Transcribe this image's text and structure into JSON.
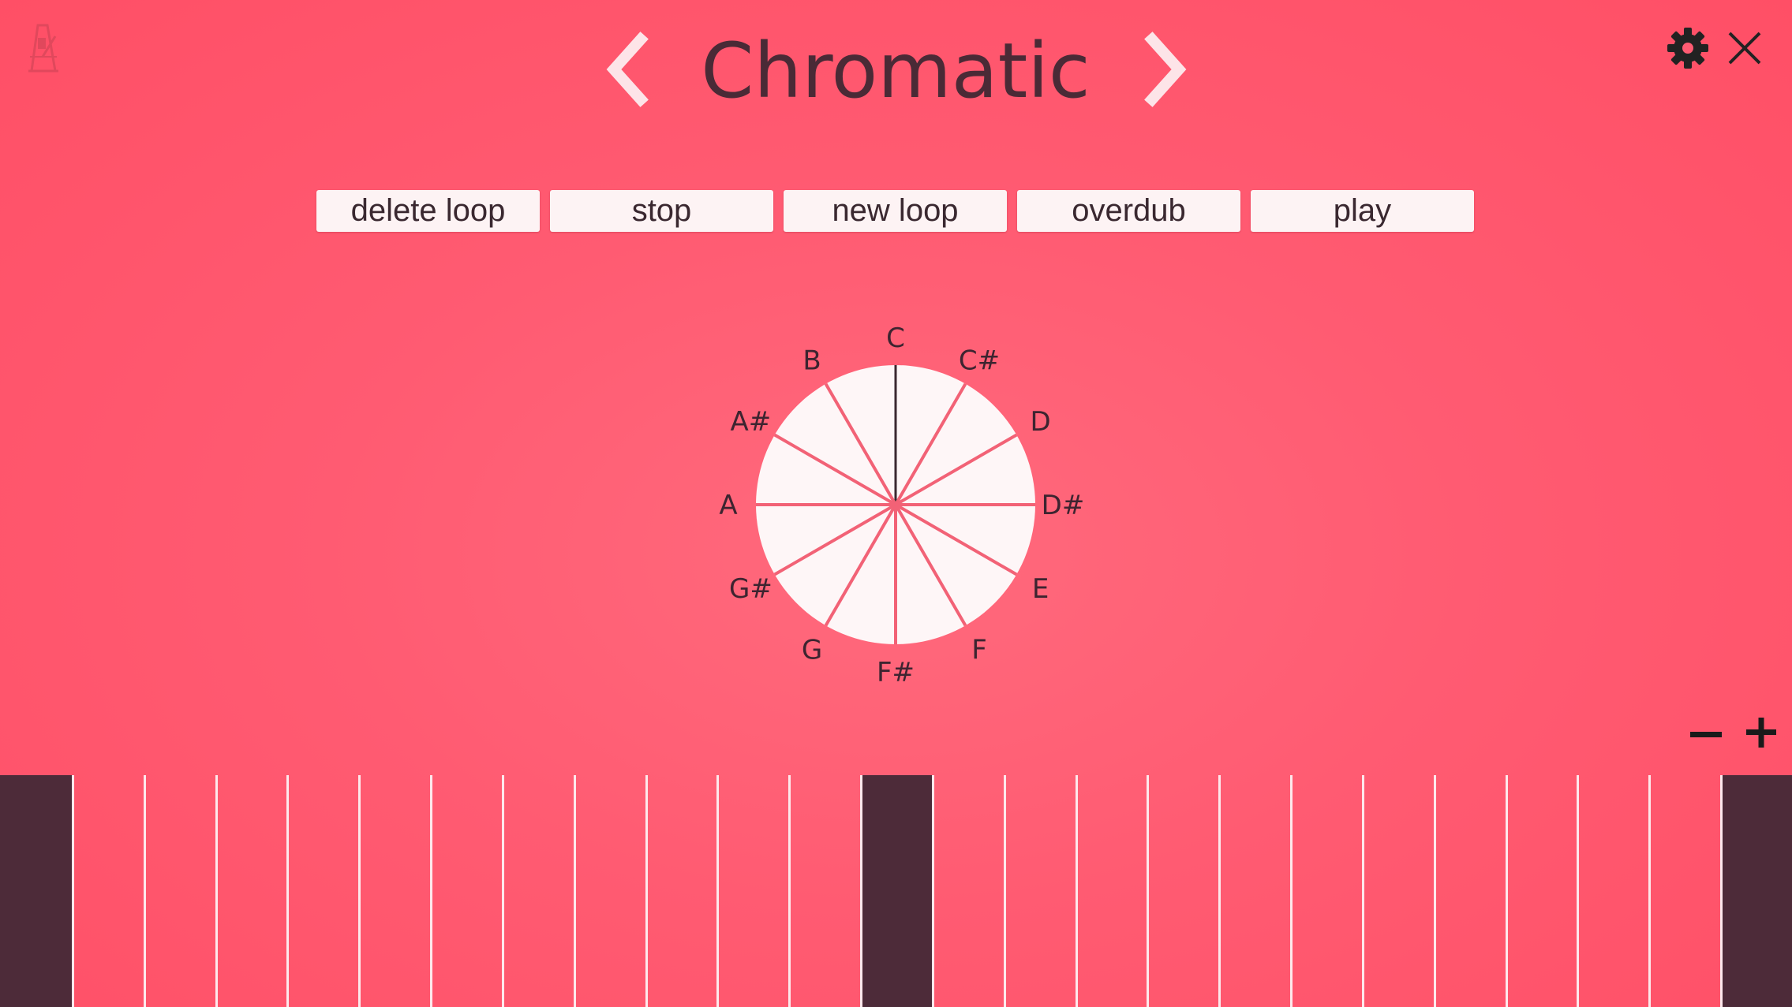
{
  "header": {
    "title": "Chromatic",
    "icons": {
      "metronome": "metronome-icon",
      "prev": "chevron-left-icon",
      "next": "chevron-right-icon",
      "settings": "gear-icon",
      "close": "close-icon"
    }
  },
  "loop_controls": {
    "delete_loop": "delete loop",
    "stop": "stop",
    "new_loop": "new loop",
    "overdub": "overdub",
    "play": "play"
  },
  "note_wheel": {
    "notes": [
      "C",
      "C#",
      "D",
      "D#",
      "E",
      "F",
      "F#",
      "G",
      "G#",
      "A",
      "A#",
      "B"
    ],
    "selected_note": "C"
  },
  "zoom": {
    "minus_icon": "minus-icon",
    "plus_icon": "plus-icon"
  },
  "keyboard": {
    "key_count": 25,
    "highlighted_keys": [
      0,
      12,
      24
    ]
  },
  "colors": {
    "background": "#ff5b72",
    "accent_dark": "#4d2b39",
    "key_highlight": "#4d2b39",
    "key_divider": "#fde8ec",
    "button_bg": "#fdf3f4",
    "wheel_fill": "#fef6f7",
    "wheel_lines": "#f26276",
    "selected_line": "#3a2830"
  }
}
